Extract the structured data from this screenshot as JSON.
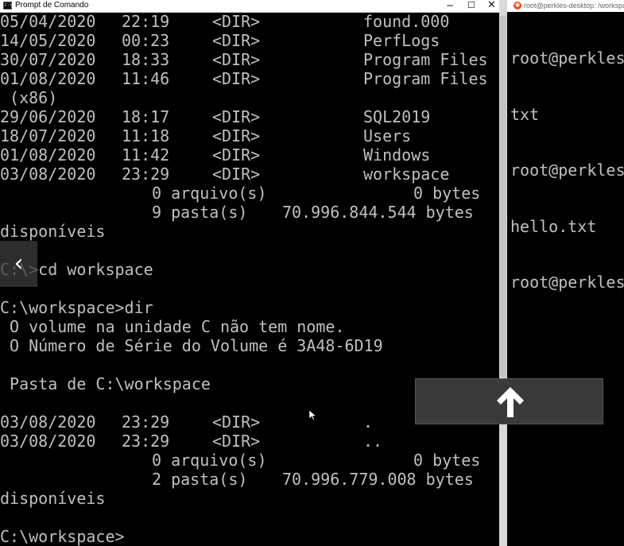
{
  "cmd_window": {
    "title": "Prompt de Comando",
    "controls": {
      "minimize": "─",
      "maximize": "☐",
      "close": "✕"
    },
    "listing1": [
      {
        "date": "05/04/2020",
        "time": "22:19",
        "type": "<DIR>",
        "name": "found.000"
      },
      {
        "date": "14/05/2020",
        "time": "00:23",
        "type": "<DIR>",
        "name": "PerfLogs"
      },
      {
        "date": "30/07/2020",
        "time": "18:33",
        "type": "<DIR>",
        "name": "Program Files"
      },
      {
        "date": "01/08/2020",
        "time": "11:46",
        "type": "<DIR>",
        "name": "Program Files"
      }
    ],
    "wrap1": " (x86)",
    "listing2": [
      {
        "date": "29/06/2020",
        "time": "18:17",
        "type": "<DIR>",
        "name": "SQL2019"
      },
      {
        "date": "18/07/2020",
        "time": "11:18",
        "type": "<DIR>",
        "name": "Users"
      },
      {
        "date": "01/08/2020",
        "time": "11:42",
        "type": "<DIR>",
        "name": "Windows"
      },
      {
        "date": "03/08/2020",
        "time": "23:29",
        "type": "<DIR>",
        "name": "workspace"
      }
    ],
    "summary1": {
      "files_count": "0 arquivo(s)",
      "files_bytes": "0 bytes",
      "dirs_count": "9 pasta(s)",
      "dirs_bytes": "70.996.844.544 bytes",
      "available": "disponíveis"
    },
    "prompt_cd": "C:\\>cd workspace",
    "prompt_dir": "C:\\workspace>dir",
    "volume_line": " O volume na unidade C não tem nome.",
    "serial_line": " O Número de Série do Volume é 3A48-6D19",
    "folder_line": " Pasta de C:\\workspace",
    "listing3": [
      {
        "date": "03/08/2020",
        "time": "23:29",
        "type": "<DIR>",
        "name": "."
      },
      {
        "date": "03/08/2020",
        "time": "23:29",
        "type": "<DIR>",
        "name": ".."
      }
    ],
    "summary2": {
      "files_count": "0 arquivo(s)",
      "files_bytes": "0 bytes",
      "dirs_count": "2 pasta(s)",
      "dirs_bytes": "70.996.779.008 bytes",
      "available": "disponíveis"
    },
    "prompt_final": "C:\\workspace>"
  },
  "wsl_window": {
    "icon_glyph": "◉",
    "title": "root@perkles-desktop: /workspace",
    "lines": [
      "root@perkles",
      "txt",
      "root@perkles",
      "hello.txt",
      "root@perkles"
    ]
  },
  "overlays": {
    "back_glyph": "‹"
  },
  "colors": {
    "terminal_bg": "#000000",
    "terminal_fg": "#c0c0c0",
    "overlay_bg": "#3a3a3a",
    "ubuntu_orange": "#e95420"
  }
}
